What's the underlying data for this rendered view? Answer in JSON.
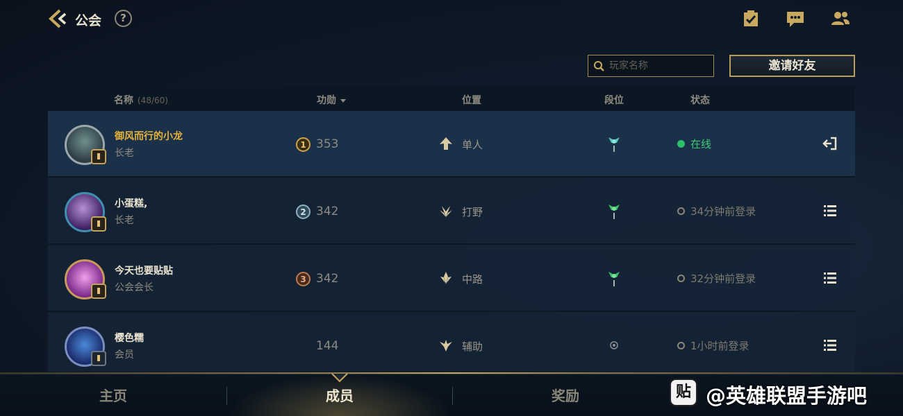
{
  "header": {
    "title": "公会",
    "help_glyph": "?",
    "icons": [
      "back-icon",
      "help-icon",
      "clipboard-check-icon",
      "chat-bubble-icon",
      "friends-icon"
    ]
  },
  "toolbar": {
    "search_placeholder": "玩家名称",
    "search_value": "",
    "invite_label": "邀请好友"
  },
  "table": {
    "columns": {
      "name": "名称",
      "count": "(48/60)",
      "merit": "功勋",
      "position": "位置",
      "tier": "段位",
      "status": "状态"
    },
    "rows": [
      {
        "name": "御风而行的小龙",
        "title": "长老",
        "merit_rank": "1",
        "merit": "353",
        "role": "单人",
        "role_icon": "top-lane-icon",
        "status": "在线",
        "online": true,
        "action": "leave-icon"
      },
      {
        "name": "小蛋糕,",
        "title": "长老",
        "merit_rank": "2",
        "merit": "342",
        "role": "打野",
        "role_icon": "jungle-icon",
        "status": "34分钟前登录",
        "online": false,
        "action": "menu-icon"
      },
      {
        "name": "今天也要贴贴",
        "title": "公会会长",
        "merit_rank": "3",
        "merit": "342",
        "role": "中路",
        "role_icon": "mid-lane-icon",
        "status": "32分钟前登录",
        "online": false,
        "action": "menu-icon"
      },
      {
        "name": "樱色糯",
        "title": "会员",
        "merit_rank": "",
        "merit": "144",
        "role": "辅助",
        "role_icon": "support-icon",
        "status": "1小时前登录",
        "online": false,
        "action": "menu-icon"
      }
    ]
  },
  "bottom_nav": {
    "tabs": [
      "主页",
      "成员",
      "奖励"
    ],
    "active": "成员"
  },
  "watermark": {
    "logo": "贴",
    "text": "@英雄联盟手游吧"
  },
  "colors": {
    "gold": "#e6b33a",
    "online_green": "#2fbf6a",
    "frame_gold": "#b99b5a",
    "panel": "#132131"
  }
}
